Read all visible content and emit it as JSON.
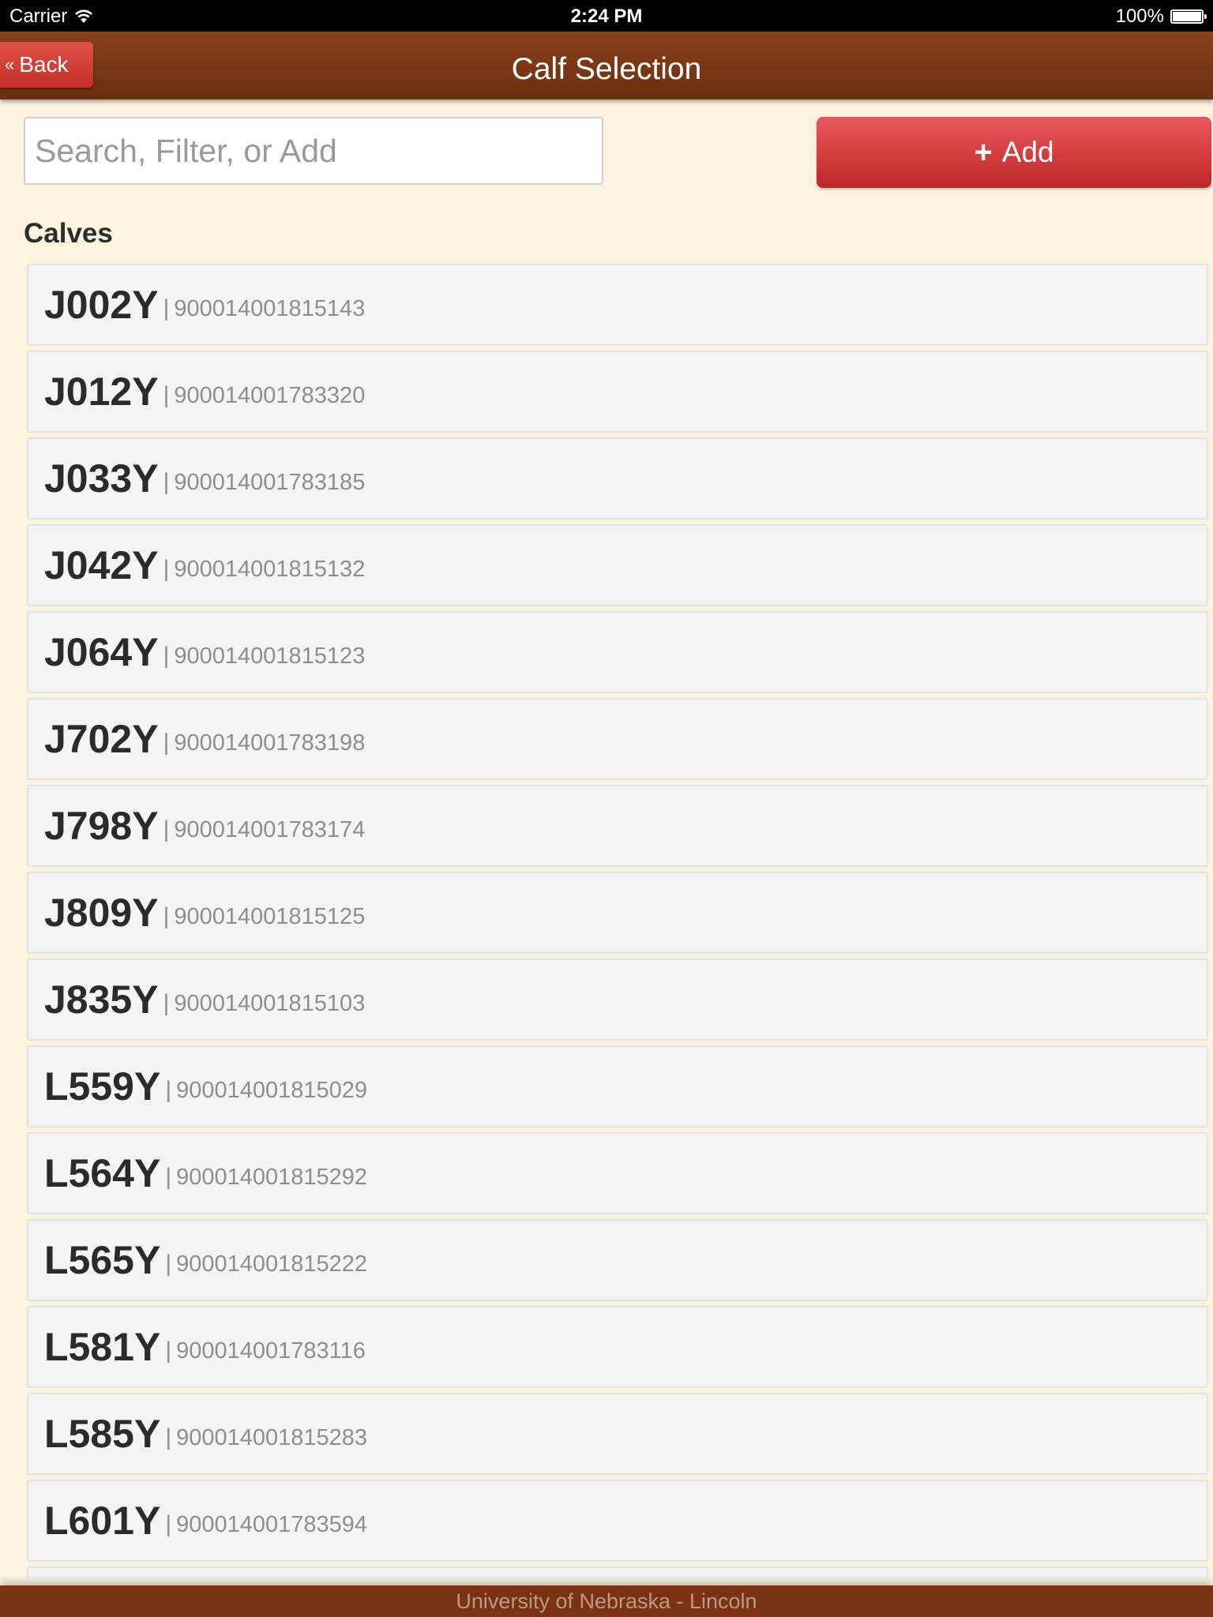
{
  "status_bar": {
    "carrier": "Carrier",
    "time": "2:24 PM",
    "battery": "100%"
  },
  "header": {
    "back_chevron": "«",
    "back_label": "Back",
    "title": "Calf Selection"
  },
  "toolbar": {
    "search_placeholder": "Search, Filter, or Add",
    "add_icon": "+",
    "add_label": "Add"
  },
  "section": {
    "title": "Calves"
  },
  "calves": [
    {
      "tag": "J002Y",
      "sep": "|",
      "id": "900014001815143"
    },
    {
      "tag": "J012Y",
      "sep": "|",
      "id": "900014001783320"
    },
    {
      "tag": "J033Y",
      "sep": "|",
      "id": "900014001783185"
    },
    {
      "tag": "J042Y",
      "sep": "|",
      "id": "900014001815132"
    },
    {
      "tag": "J064Y",
      "sep": "|",
      "id": "900014001815123"
    },
    {
      "tag": "J702Y",
      "sep": "|",
      "id": "900014001783198"
    },
    {
      "tag": "J798Y",
      "sep": "|",
      "id": "900014001783174"
    },
    {
      "tag": "J809Y",
      "sep": "|",
      "id": "900014001815125"
    },
    {
      "tag": "J835Y",
      "sep": "|",
      "id": "900014001815103"
    },
    {
      "tag": "L559Y",
      "sep": "|",
      "id": "900014001815029"
    },
    {
      "tag": "L564Y",
      "sep": "|",
      "id": "900014001815292"
    },
    {
      "tag": "L565Y",
      "sep": "|",
      "id": "900014001815222"
    },
    {
      "tag": "L581Y",
      "sep": "|",
      "id": "900014001783116"
    },
    {
      "tag": "L585Y",
      "sep": "|",
      "id": "900014001815283"
    },
    {
      "tag": "L601Y",
      "sep": "|",
      "id": "900014001783594"
    },
    {
      "tag": "",
      "sep": "",
      "id": ""
    }
  ],
  "footer": {
    "text": "University of Nebraska - Lincoln"
  },
  "colors": {
    "header_brown": "#7a3515",
    "accent_red": "#d03a36",
    "background_cream": "#fdf4df",
    "row_gray": "#f4f4f4"
  },
  "icons": {
    "wifi": "wifi-icon",
    "battery": "battery-icon",
    "plus": "plus-icon",
    "back": "chevron-left-double-icon"
  }
}
